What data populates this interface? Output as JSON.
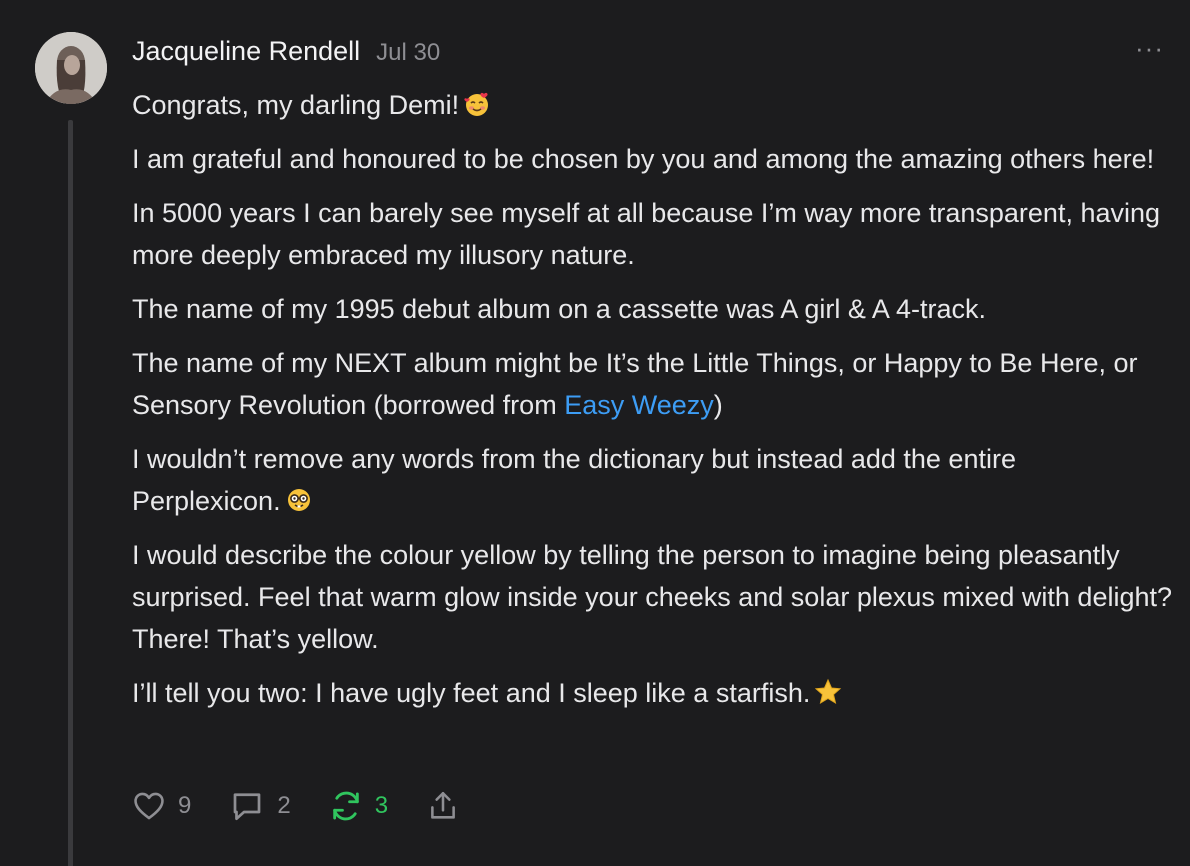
{
  "comment": {
    "author": "Jacqueline Rendell",
    "date": "Jul 30",
    "more_label": "···",
    "paragraphs": {
      "p1": "Congrats, my darling Demi!",
      "p2": "I am grateful and honoured to be chosen by you and among the amazing others here!",
      "p3": "In 5000 years I can barely see myself at all because I’m way more transparent, having more deeply embraced my illusory nature.",
      "p4": "The name of my 1995 debut album on a cassette was A girl & A 4-track.",
      "p5_before": "The name of my NEXT album might be It’s the Little Things, or Happy to Be Here, or Sensory Revolution (borrowed from ",
      "p5_link": "Easy Weezy",
      "p5_after": ")",
      "p6": "I wouldn’t remove any words from the dictionary but instead add the entire Perplexicon.",
      "p7": "I would describe the colour yellow by telling the person to imagine being pleasantly surprised. Feel that warm glow inside your cheeks and solar plexus mixed with delight? There! That’s yellow.",
      "p8": "I’ll tell you two: I have ugly feet and I sleep like a starfish."
    },
    "emojis": [
      "smiling-face-with-hearts-icon",
      "nerd-face-icon",
      "star-icon"
    ]
  },
  "actions": {
    "likes": "9",
    "replies": "2",
    "restacks": "3"
  },
  "colors": {
    "background": "#1c1c1e",
    "link": "#3d9df5",
    "restack": "#30c55e",
    "muted": "#8e8e93"
  }
}
